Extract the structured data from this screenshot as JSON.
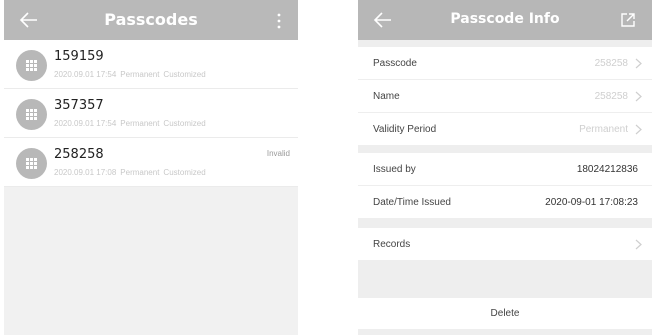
{
  "left": {
    "title": "Passcodes",
    "items": [
      {
        "code": "159159",
        "date": "2020.09.01 17:54",
        "type": "Permanent",
        "source": "Customized",
        "status": ""
      },
      {
        "code": "357357",
        "date": "2020.09.01 17:54",
        "type": "Permanent",
        "source": "Customized",
        "status": ""
      },
      {
        "code": "258258",
        "date": "2020.09.01 17:08",
        "type": "Permanent",
        "source": "Customized",
        "status": "Invalid"
      }
    ]
  },
  "right": {
    "title": "Passcode Info",
    "passcode": {
      "label": "Passcode",
      "value": "258258"
    },
    "name": {
      "label": "Name",
      "value": "258258"
    },
    "validity": {
      "label": "Validity Period",
      "value": "Permanent"
    },
    "issued_by": {
      "label": "Issued by",
      "value": "18024212836"
    },
    "issued_time": {
      "label": "Date/Time Issued",
      "value": "2020-09-01 17:08:23"
    },
    "records": {
      "label": "Records"
    },
    "delete_label": "Delete"
  },
  "colors": {
    "appbar": "#b9b9b9",
    "background": "#f1f1f1"
  },
  "icons": {
    "back": "back-arrow-icon",
    "menu": "more-vertical-icon",
    "share": "share-icon",
    "avatar": "keypad-icon",
    "chevron": "chevron-right-icon"
  }
}
